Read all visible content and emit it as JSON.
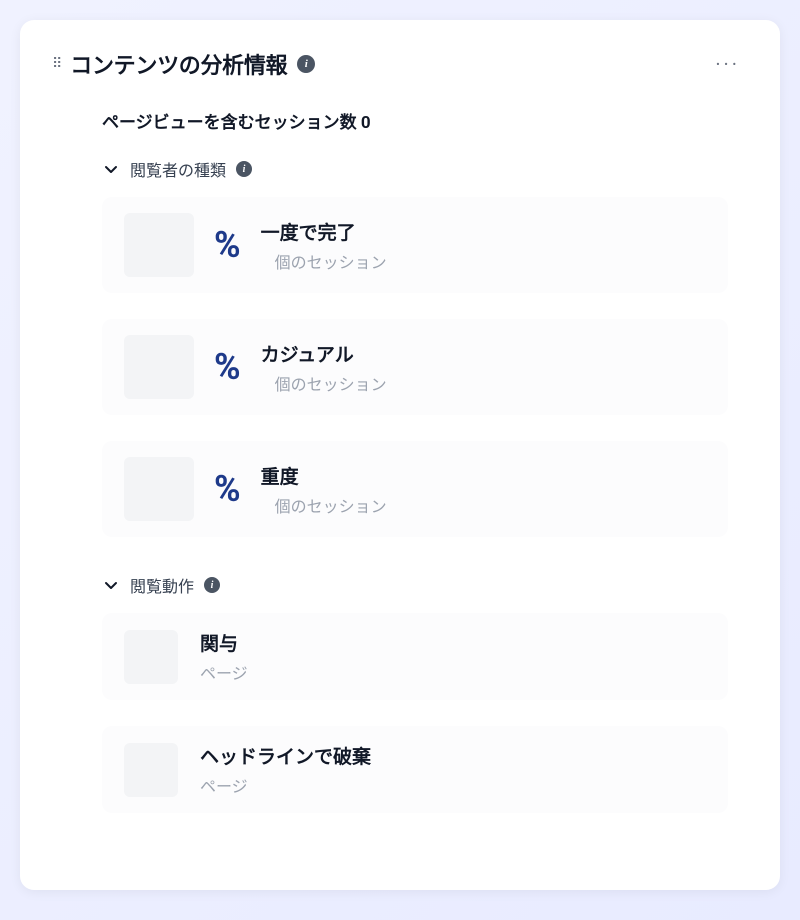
{
  "header": {
    "title": "コンテンツの分析情報"
  },
  "summary": {
    "sessions_label": "ページビューを含むセッション数",
    "sessions_value": "0"
  },
  "sections": {
    "reader_type": {
      "title": "閲覧者の種類",
      "items": [
        {
          "label": "一度で完了",
          "sub": "個のセッション",
          "percent": "%"
        },
        {
          "label": "カジュアル",
          "sub": "個のセッション",
          "percent": "%"
        },
        {
          "label": "重度",
          "sub": "個のセッション",
          "percent": "%"
        }
      ]
    },
    "behavior": {
      "title": "閲覧動作",
      "items": [
        {
          "label": "関与",
          "sub": "ページ"
        },
        {
          "label": "ヘッドラインで破棄",
          "sub": "ページ"
        }
      ]
    }
  }
}
